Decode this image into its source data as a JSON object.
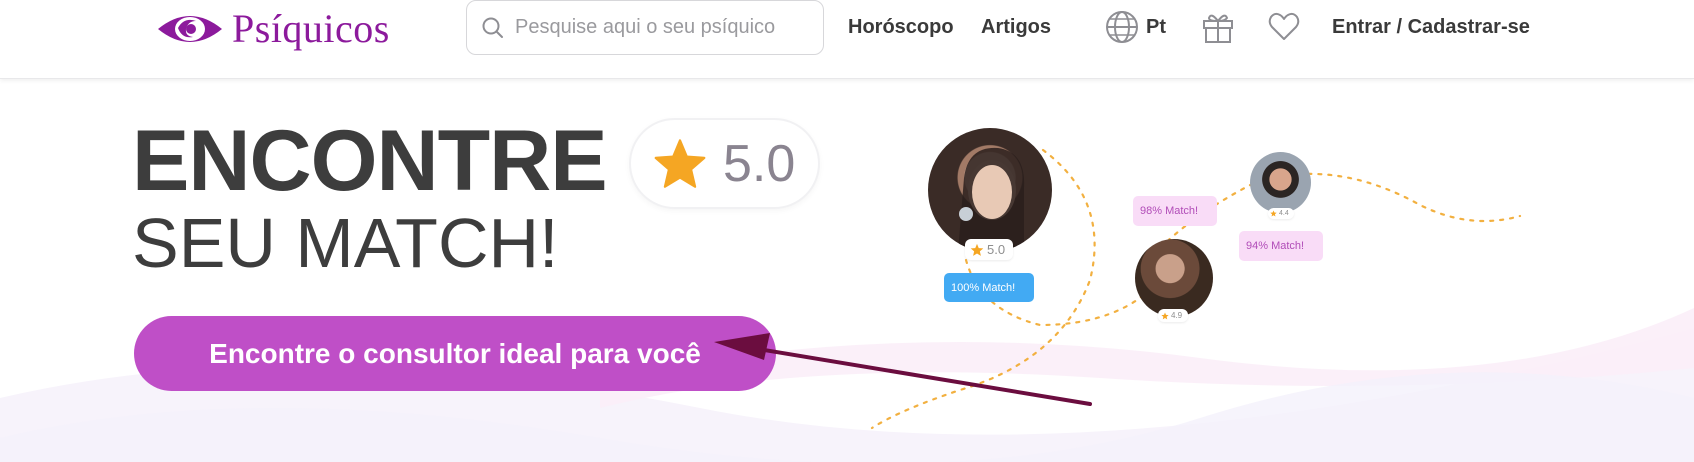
{
  "header": {
    "logo_text": "Psíquicos",
    "search_placeholder": "Pesquise aqui o seu psíquico",
    "nav": [
      "Horóscopo",
      "Artigos"
    ],
    "language": "Pt",
    "auth_label": "Entrar / Cadastrar-se",
    "icons": [
      "logo-eye-icon",
      "search-icon",
      "globe-icon",
      "gift-icon",
      "heart-icon"
    ]
  },
  "hero": {
    "title": "ENCONTRE",
    "subtitle": "SEU MATCH!",
    "rating": "5.0",
    "cta_label": "Encontre o consultor ideal para você"
  },
  "profiles": [
    {
      "rating": "5.0",
      "match": "100% Match!"
    },
    {
      "rating": "4.9",
      "match": "98% Match!"
    },
    {
      "rating": "4.4",
      "match": "94% Match!"
    }
  ],
  "colors": {
    "brand_purple": "#8c1a9c",
    "cta": "#bf4fc7",
    "star": "#f5a623",
    "match_blue": "#42aaf3",
    "match_pink": "#f9dcf7",
    "arrow": "#6b0d3f"
  }
}
